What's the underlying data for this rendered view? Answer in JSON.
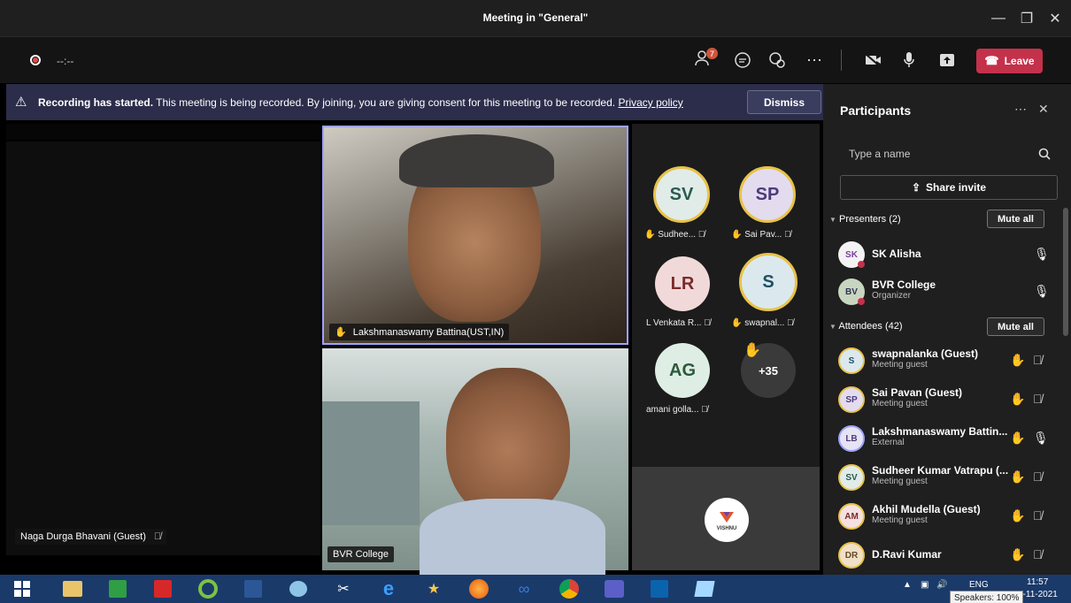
{
  "window": {
    "title": "Meeting in \"General\""
  },
  "toolbar": {
    "timer": "--:--",
    "participants_badge": "7",
    "leave_label": "Leave"
  },
  "banner": {
    "bold": "Recording has started.",
    "text": "This meeting is being recorded. By joining, you are giving consent for this meeting to be recorded.",
    "link": "Privacy policy",
    "dismiss_label": "Dismiss"
  },
  "stage": {
    "left_tile_name": "Naga Durga Bhavani (Guest)",
    "video_top_name": "Lakshmanaswamy Battina(UST,IN)",
    "video_bottom_name": "BVR College",
    "avatars": [
      {
        "initials": "SV",
        "label": "Sudhee...",
        "bg": "#e1ece9",
        "fg": "#2b5a4f",
        "ring": "#e8c24a",
        "hand": true
      },
      {
        "initials": "SP",
        "label": "Sai Pav...",
        "bg": "#e3dcef",
        "fg": "#4d3b7a",
        "ring": "#e8c24a",
        "hand": true
      },
      {
        "initials": "LR",
        "label": "L Venkata R...",
        "bg": "#f2d9d9",
        "fg": "#7a2b2b",
        "ring": "",
        "hand": false
      },
      {
        "initials": "S",
        "label": "swapnal...",
        "bg": "#dbe9ee",
        "fg": "#1f4f63",
        "ring": "#e8c24a",
        "hand": true
      },
      {
        "initials": "AG",
        "label": "amani golla...",
        "bg": "#dfeee5",
        "fg": "#2c5a3d",
        "ring": "",
        "hand": false
      }
    ],
    "overflow": "+35",
    "logo_text": "VISHNU"
  },
  "participants": {
    "title": "Participants",
    "search_placeholder": "Type a name",
    "share_label": "Share invite",
    "presenters_label": "Presenters (2)",
    "attendees_label": "Attendees (42)",
    "mute_all": "Mute all",
    "presenters": [
      {
        "name": "SK Alisha",
        "sub": "",
        "initials": "SK",
        "bg": "#f3f3f3"
      },
      {
        "name": "BVR College",
        "sub": "Organizer",
        "initials": "BV",
        "bg": "#c8d6c0"
      }
    ],
    "attendees": [
      {
        "name": "swapnalanka (Guest)",
        "sub": "Meeting guest",
        "initials": "S",
        "bg": "#dbe9ee"
      },
      {
        "name": "Sai Pavan (Guest)",
        "sub": "Meeting guest",
        "initials": "SP",
        "bg": "#e3dcef"
      },
      {
        "name": "Lakshmanaswamy Battin...",
        "sub": "External",
        "initials": "LB",
        "bg": "#e6e3f3"
      },
      {
        "name": "Sudheer Kumar Vatrapu (...",
        "sub": "Meeting guest",
        "initials": "SV",
        "bg": "#e1ece9"
      },
      {
        "name": "Akhil Mudella (Guest)",
        "sub": "Meeting guest",
        "initials": "AM",
        "bg": "#f5e1e1"
      },
      {
        "name": "D.Ravi Kumar",
        "sub": "",
        "initials": "DR",
        "bg": "#f0e0c8"
      }
    ]
  },
  "taskbar": {
    "time": "11:57",
    "date": "1-11-2021",
    "lang": "ENG",
    "tooltip": "Speakers: 100%"
  }
}
